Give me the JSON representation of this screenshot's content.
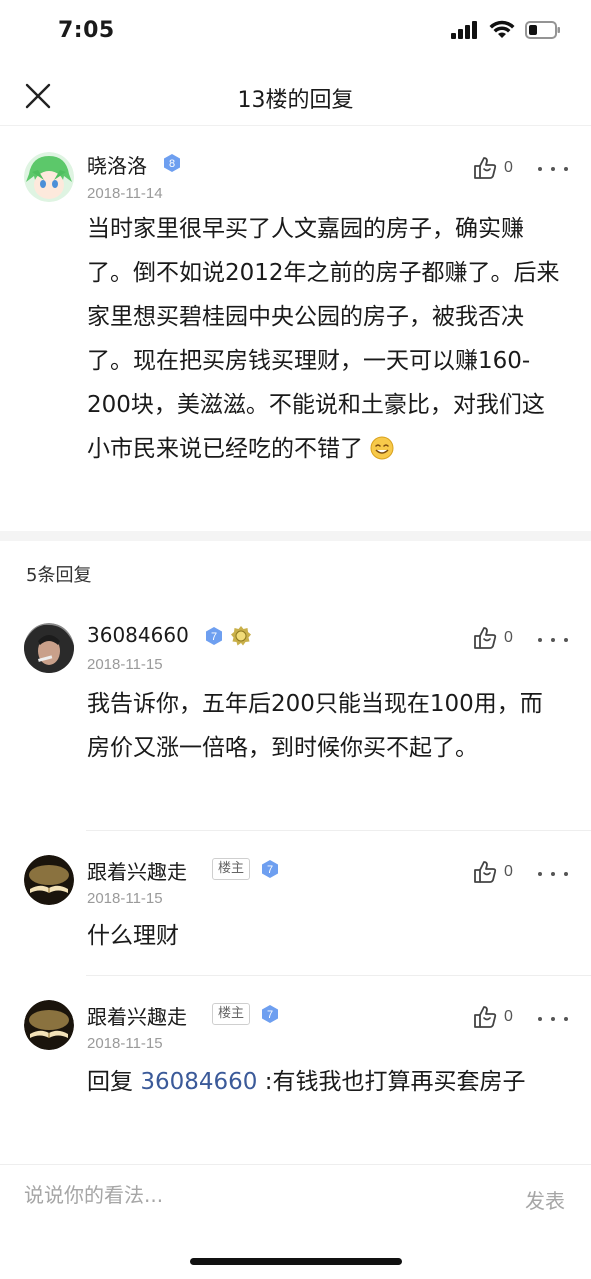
{
  "status_bar": {
    "time": "7:05"
  },
  "nav": {
    "title": "13楼的回复"
  },
  "main_post": {
    "username": "晓洛洛",
    "level": "8",
    "date": "2018-11-14",
    "likes": "0",
    "content": "当时家里很早买了人文嘉园的房子，确实赚了。倒不如说2012年之前的房子都赚了。后来家里想买碧桂园中央公园的房子，被我否决了。现在把买房钱买理财，一天可以赚160-200块，美滋滋。不能说和土豪比，对我们这小市民来说已经吃的不错了"
  },
  "reply_count": "5条回复",
  "replies": [
    {
      "username": "36084660",
      "level": "7",
      "date": "2018-11-15",
      "likes": "0",
      "content": "我告诉你，五年后200只能当现在100用，而房价又涨一倍咯，到时候你买不起了。"
    },
    {
      "username": "跟着兴趣走",
      "tag": "楼主",
      "level": "7",
      "date": "2018-11-15",
      "likes": "0",
      "content": "什么理财"
    },
    {
      "username": "跟着兴趣走",
      "tag": "楼主",
      "level": "7",
      "date": "2018-11-15",
      "likes": "0",
      "reply_prefix": "回复 ",
      "mention": "36084660",
      "content": " :有钱我也打算再买套房子"
    }
  ],
  "composer": {
    "placeholder": "说说你的看法...",
    "send_label": "发表"
  },
  "colors": {
    "badge_blue": "#6e9ff0",
    "mention": "#3b5a99",
    "text_gray": "#9a9a9a"
  }
}
